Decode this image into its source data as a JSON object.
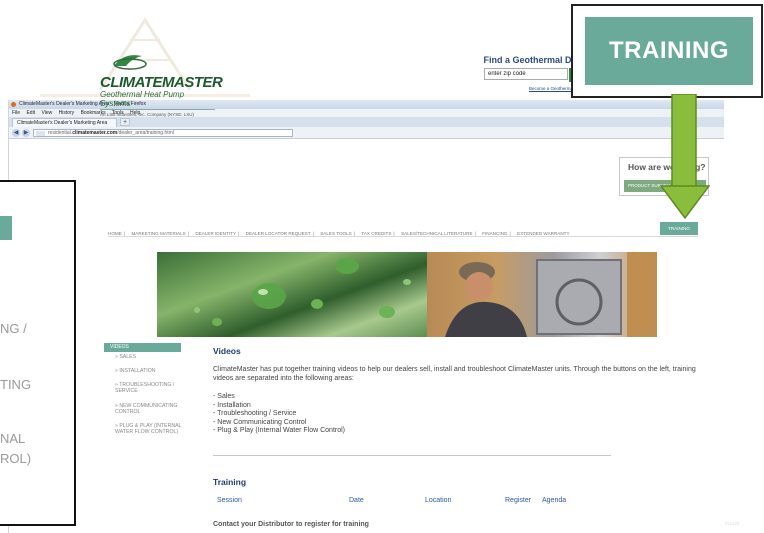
{
  "browser": {
    "title": "ClimateMaster's Dealer's Marketing Area - Mozilla Firefox",
    "menu": [
      "File",
      "Edit",
      "View",
      "History",
      "Bookmarks",
      "Tools",
      "Help"
    ],
    "tab_label": "ClimateMaster's Dealer's Marketing Area",
    "new_tab": "+",
    "back": "◀",
    "forward": "▶",
    "url_prefix": "residential.",
    "url_domain": "climatemaster.com",
    "url_path": "/dealer_area/training.html"
  },
  "header": {
    "logo_name": "CLIMATEMASTER",
    "logo_tagline": "Geothermal Heat Pump Systems",
    "logo_corp": "An LSB Industries, Inc. Company (NYSE: LXU)"
  },
  "driller": {
    "title": "Find a Geothermal Driller",
    "zip_value": "enter zip code",
    "go": "▶",
    "link": "Become a Geothermal Driller"
  },
  "howare": {
    "title": "How are we doing?",
    "button": "PRODUCT SURVEY"
  },
  "nav": {
    "items": [
      "HOME",
      "MARKETING MATERIALS",
      "DEALER IDENTITY",
      "DEALER LOCATOR REQUEST",
      "SALES TOOLS",
      "TAX CREDITS",
      "SALES/TECHNICAL LITERATURE",
      "FINANCING",
      "EXTENDED WARRANTY"
    ],
    "separator": "|",
    "active": "TRAINING"
  },
  "sidebar": {
    "header": "VIDEOS",
    "items": [
      "SALES",
      "INSTALLATION",
      "TROUBLESHOOTING / SERVICE",
      "NEW COMMUNICATING CONTROL",
      "PLUG & PLAY (INTERNAL WATER FLOW CONTROL)"
    ],
    "bullet": "»"
  },
  "content": {
    "heading": "Videos",
    "intro": "ClimateMaster has put together training videos to help our dealers sell, install and troubleshoot ClimateMaster units. Through the buttons on the left, training videos are separated into the following areas:",
    "areas": [
      "- Sales",
      "- Installation",
      "- Troubleshooting / Service",
      "- New Communicating Control",
      "- Plug & Play (Internal Water Flow Control)"
    ],
    "training_heading": "Training",
    "table_headers": [
      "Session",
      "Date",
      "Location",
      "Register",
      "Agenda"
    ],
    "contact": "Contact your Distributor to register for training"
  },
  "callout": {
    "training_label": "TRAINING",
    "left_lines": [
      "NG /",
      "TING",
      "NAL",
      "ROL)"
    ]
  },
  "colors": {
    "accent_teal": "#6aaa9a",
    "arrow_green": "#8bbd3c",
    "link_blue": "#2c57a8",
    "heading_navy": "#1f3d6e",
    "brand_green": "#1d5a2b"
  }
}
